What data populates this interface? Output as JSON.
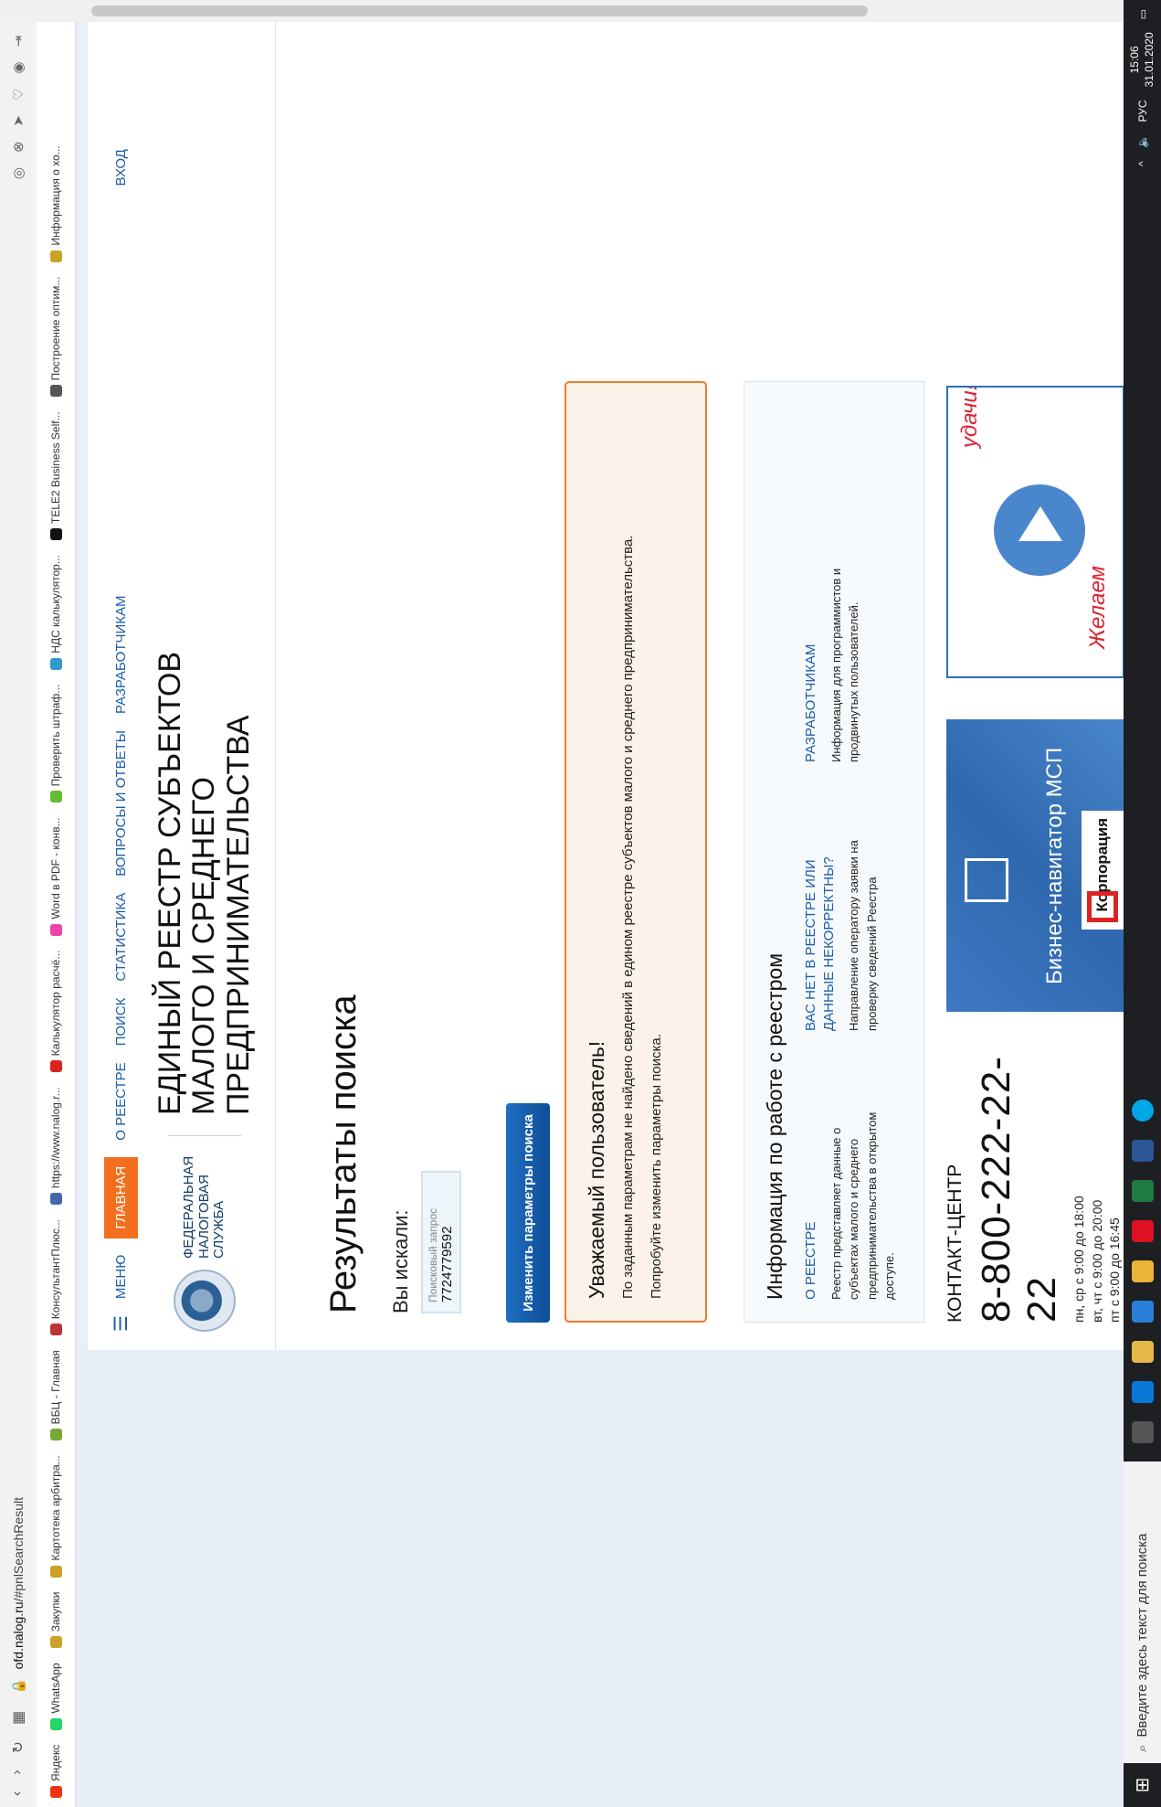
{
  "browser": {
    "url_host": "ofd.nalog.ru",
    "url_rest": "/#pnlSearchResult",
    "bookmarks": [
      {
        "label": "Яндекс",
        "color": "#e31"
      },
      {
        "label": "WhatsApp",
        "color": "#25d366"
      },
      {
        "label": "Закупки",
        "color": "#c9a227"
      },
      {
        "label": "Картотека арбитра...",
        "color": "#c9a227"
      },
      {
        "label": "ВБЦ - Главная",
        "color": "#7a3"
      },
      {
        "label": "КонсультантПлюс...",
        "color": "#b33"
      },
      {
        "label": "https://www.nalog.r...",
        "color": "#46a"
      },
      {
        "label": "Калькулятор расчё...",
        "color": "#d22"
      },
      {
        "label": "Word в PDF - конв...",
        "color": "#e4a"
      },
      {
        "label": "Проверить штраф...",
        "color": "#6b3"
      },
      {
        "label": "НДС калькулятор...",
        "color": "#39c"
      },
      {
        "label": "TELE2 Business Self...",
        "color": "#111"
      },
      {
        "label": "Построение оптим...",
        "color": "#555"
      },
      {
        "label": "Информация о хо...",
        "color": "#c9a227"
      }
    ]
  },
  "menu": {
    "burger": "☰",
    "menu_label": "МЕНЮ",
    "items": [
      "ГЛАВНАЯ",
      "О РЕЕСТРЕ",
      "ПОИСК",
      "СТАТИСТИКА",
      "ВОПРОСЫ И ОТВЕТЫ",
      "РАЗРАБОТЧИКАМ"
    ],
    "login": "ВХОД"
  },
  "logo": {
    "org": "ФЕДЕРАЛЬНАЯ НАЛОГОВАЯ СЛУЖБА",
    "title_line1": "ЕДИНЫЙ РЕЕСТР СУБЪЕКТОВ МАЛОГО И СРЕДНЕГО",
    "title_line2": "ПРЕДПРИНИМАТЕЛЬСТВА"
  },
  "results": {
    "title": "Результаты поиска",
    "you_searched": "Вы искали:",
    "query_label": "Поисковый запрос",
    "query_value": "7724779592",
    "change_button": "Изменить параметры поиска"
  },
  "alert": {
    "title": "Уважаемый пользователь!",
    "line1": "По заданным параметрам не найдено сведений в едином реестре субъектов малого и среднего предпринимательства.",
    "line2": "Попробуйте изменить параметры поиска."
  },
  "info": {
    "title": "Информация по работе с реестром",
    "cols": [
      {
        "heading": "О РЕЕСТРЕ",
        "text": "Реестр представляет данные о субъектах малого и среднего предпринимательства в открытом доступе."
      },
      {
        "heading": "ВАС НЕТ В РЕЕСТРЕ ИЛИ ДАННЫЕ НЕКОРРЕКТНЫ?",
        "text": "Направление оператору заявки на проверку сведений Реестра"
      },
      {
        "heading": "РАЗРАБОТЧИКАМ",
        "text": "Информация для программистов и продвинутых пользователей."
      }
    ]
  },
  "contact": {
    "title": "КОНТАКТ-ЦЕНТР",
    "phone": "8-800-222-22-22",
    "hours1": "пн, ср с 9:00 до 18:00",
    "hours2": "вт, чт с 9:00 до 20:00",
    "hours3": "пт с 9:00 до 16:45"
  },
  "banners": {
    "msp": "Бизнес-навигатор МСП",
    "corp": "Корпорация",
    "wish1": "Желаем",
    "wish2": "удачи!!!"
  },
  "taskbar": {
    "search_placeholder": "Введите здесь текст для поиска",
    "lang": "РУС",
    "time": "15:06",
    "date": "31.01.2020"
  }
}
